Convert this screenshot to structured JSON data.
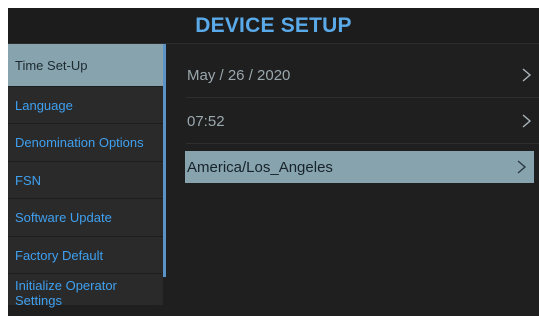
{
  "header": {
    "title": "DEVICE SETUP"
  },
  "sidebar": {
    "items": [
      {
        "label": "Time Set-Up"
      },
      {
        "label": "Language"
      },
      {
        "label": "Denomination Options"
      },
      {
        "label": "FSN"
      },
      {
        "label": "Software Update"
      },
      {
        "label": "Factory Default"
      },
      {
        "label": "Initialize Operator Settings"
      }
    ],
    "active_index": 0
  },
  "content": {
    "rows": [
      {
        "value": "May / 26 / 2020",
        "icon": "chevron-right-icon"
      },
      {
        "value": "07:52",
        "icon": "chevron-right-icon"
      },
      {
        "value": "America/Los_Angeles",
        "icon": "chevron-right-icon"
      }
    ],
    "selected_index": 2
  },
  "colors": {
    "title": "#5aa9e8",
    "sidebar_text": "#3fa0f0",
    "highlight": "#87a3ad",
    "background": "#1f1f1f"
  }
}
